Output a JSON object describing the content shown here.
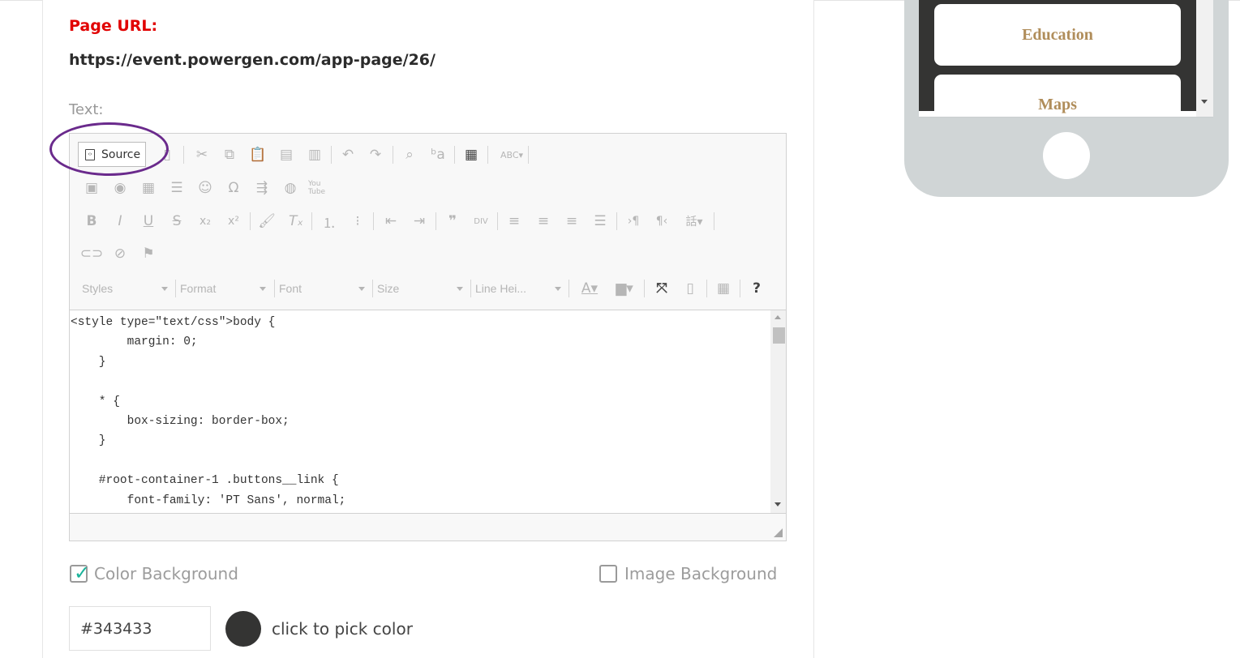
{
  "page": {
    "url_label": "Page URL:",
    "url_value": "https://event.powergen.com/app-page/26/",
    "text_label": "Text:"
  },
  "editor": {
    "source_button_label": "Source",
    "dropdowns": {
      "styles": "Styles",
      "format": "Format",
      "font": "Font",
      "size": "Size",
      "line_height": "Line Hei..."
    },
    "code_lines": [
      "<style type=\"text/css\">body {",
      "        margin: 0;",
      "    }",
      "",
      "    * {",
      "        box-sizing: border-box;",
      "    }",
      "",
      "    #root-container-1 .buttons__link {",
      "        font-family: 'PT Sans', normal;",
      "        ..."
    ]
  },
  "background_options": {
    "color_background_label": "Color Background",
    "color_background_checked": true,
    "image_background_label": "Image Background",
    "image_background_checked": false,
    "color_value": "#343433",
    "pick_color_label": "click to pick color"
  },
  "preview": {
    "buttons": [
      "Education",
      "Maps"
    ],
    "screen_bg": "#343433",
    "button_text_color": "#b08d5a"
  },
  "colors": {
    "url_label": "#e10000",
    "annotation": "#6a2a8c",
    "check": "#19b39a",
    "phone_body": "#d0d5d6"
  }
}
